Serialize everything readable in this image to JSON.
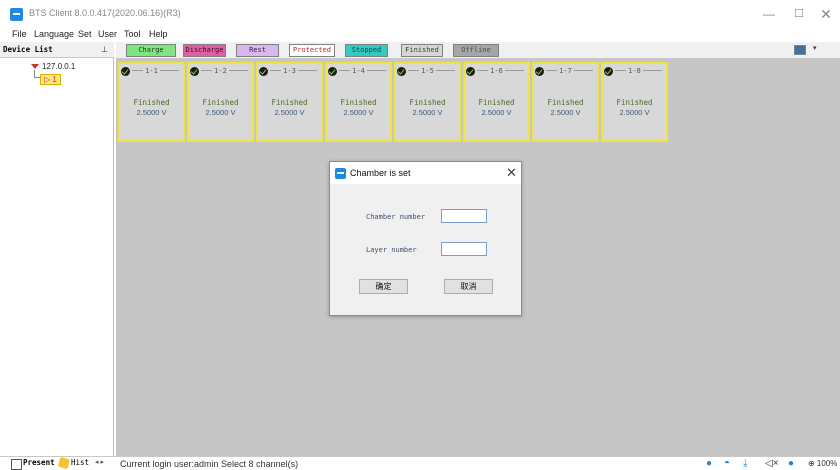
{
  "window": {
    "title": "BTS Client 8.0.0.417(2020.06.16)(R3)",
    "min_glyph": "—",
    "max_glyph": "☐",
    "close_glyph": "✕"
  },
  "menu": [
    "File",
    "Language",
    "Set",
    "User",
    "Tool",
    "Help"
  ],
  "legend": {
    "items": [
      {
        "label": "Charge",
        "bg": "#7fe67f",
        "fg": "#1a3d1a"
      },
      {
        "label": "Discharge",
        "bg": "#e05ea6",
        "fg": "#3a0d26"
      },
      {
        "label": "Rest",
        "bg": "#d9b8f0",
        "fg": "#3a2050"
      },
      {
        "label": "Protected",
        "bg": "#ffffff",
        "fg": "#b03030"
      },
      {
        "label": "Stopped",
        "bg": "#36c9c0",
        "fg": "#0e4a46"
      },
      {
        "label": "Finished",
        "bg": "#d6d6d6",
        "fg": "#2d4d1a"
      },
      {
        "label": "Offline",
        "bg": "#a6a6a6",
        "fg": "#4d4d4d"
      }
    ],
    "layout_dropdown": "▾"
  },
  "device_list": {
    "title": "Device List",
    "pin": "📌",
    "ip": "127.0.0.1",
    "node": "1",
    "node_glyph": "▷"
  },
  "channels": [
    {
      "id": "1-1",
      "status": "Finished",
      "voltage": "2.5000 V"
    },
    {
      "id": "1-2",
      "status": "Finished",
      "voltage": "2.5000 V"
    },
    {
      "id": "1-3",
      "status": "Finished",
      "voltage": "2.5000 V"
    },
    {
      "id": "1-4",
      "status": "Finished",
      "voltage": "2.5000 V"
    },
    {
      "id": "1-5",
      "status": "Finished",
      "voltage": "2.5000 V"
    },
    {
      "id": "1-6",
      "status": "Finished",
      "voltage": "2.5000 V"
    },
    {
      "id": "1-7",
      "status": "Finished",
      "voltage": "2.5000 V"
    },
    {
      "id": "1-8",
      "status": "Finished",
      "voltage": "2.5000 V"
    }
  ],
  "dialog": {
    "title": "Chamber is set",
    "close_glyph": "✕",
    "chamber_label": "Chamber number",
    "chamber_value": "",
    "layer_label": "Layer number",
    "layer_value": "",
    "ok_label": "确定",
    "cancel_label": "取消"
  },
  "status": {
    "present_tab": "Present",
    "hist_tab": "Hist",
    "tab_arrows": "◂ ▸",
    "text": "Current login user:admin  Select 8 channel(s)",
    "zoom": "⊕ 100%"
  }
}
